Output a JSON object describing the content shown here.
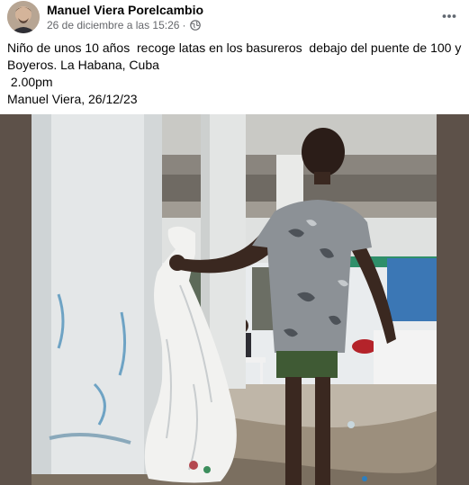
{
  "post": {
    "author": "Manuel Viera Porelcambio",
    "timestamp": "26 de diciembre a las 15:26",
    "separator": "·",
    "privacy_icon": "globe-icon",
    "more_icon": "more-horizontal-icon",
    "text_lines": [
      "Niño de unos 10 años  recoge latas en los basureros  debajo del puente de 100 y",
      "Boyeros. La Habana, Cuba",
      " 2.00pm",
      "Manuel Viera, 26/12/23"
    ]
  },
  "colors": {
    "author": "#050505",
    "meta": "#65676b",
    "photo_frame": "#5d5149"
  }
}
